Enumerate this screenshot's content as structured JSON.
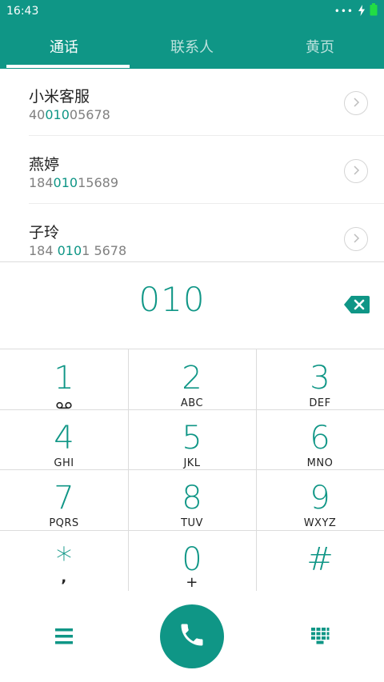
{
  "status": {
    "time": "16:43",
    "dots": "•••",
    "colors": {
      "battery": "#22dd44"
    }
  },
  "tabs": [
    {
      "label": "通话",
      "active": true
    },
    {
      "label": "联系人",
      "active": false
    },
    {
      "label": "黄页",
      "active": false
    }
  ],
  "contacts": [
    {
      "name": "小米客服",
      "number_pre": "40",
      "number_hl": "010",
      "number_post": "05678"
    },
    {
      "name": "燕婷",
      "number_pre": "184",
      "number_hl": "010",
      "number_post": "15689"
    },
    {
      "name": "子玲",
      "number_pre": "184 ",
      "number_hl": "010",
      "number_post": "1 5678"
    }
  ],
  "dial": {
    "digits": "010"
  },
  "keypad": [
    {
      "num": "1",
      "sub": ""
    },
    {
      "num": "2",
      "sub": "ABC"
    },
    {
      "num": "3",
      "sub": "DEF"
    },
    {
      "num": "4",
      "sub": "GHI"
    },
    {
      "num": "5",
      "sub": "JKL"
    },
    {
      "num": "6",
      "sub": "MNO"
    },
    {
      "num": "7",
      "sub": "PQRS"
    },
    {
      "num": "8",
      "sub": "TUV"
    },
    {
      "num": "9",
      "sub": "WXYZ"
    },
    {
      "num": "*",
      "sub": ","
    },
    {
      "num": "0",
      "sub": "+"
    },
    {
      "num": "#",
      "sub": ""
    }
  ],
  "icons": {
    "voicemail": "voicemail-icon",
    "backspace": "backspace-icon",
    "call": "phone-icon",
    "menu": "menu-icon",
    "dialpad": "dialpad-icon",
    "chevron": "chevron-right-icon"
  },
  "colors": {
    "accent": "#0f9686",
    "header": "#0f9686",
    "text": "#222222",
    "muted": "#808080"
  }
}
